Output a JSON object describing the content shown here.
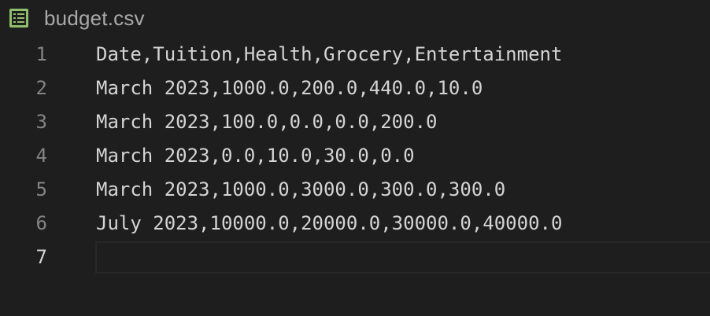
{
  "tab": {
    "file_name": "budget.csv",
    "icon": "spreadsheet-icon",
    "icon_color": "#8ec07c"
  },
  "editor": {
    "lines": [
      {
        "number": "1",
        "text": "Date,Tuition,Health,Grocery,Entertainment"
      },
      {
        "number": "2",
        "text": "March 2023,1000.0,200.0,440.0,10.0"
      },
      {
        "number": "3",
        "text": "March 2023,100.0,0.0,0.0,200.0"
      },
      {
        "number": "4",
        "text": "March 2023,0.0,10.0,30.0,0.0"
      },
      {
        "number": "5",
        "text": "March 2023,1000.0,3000.0,300.0,300.0"
      },
      {
        "number": "6",
        "text": "July 2023,10000.0,20000.0,30000.0,40000.0"
      },
      {
        "number": "7",
        "text": ""
      }
    ],
    "active_line": "7"
  },
  "colors": {
    "background": "#1e1e1e",
    "text": "#d4d4d4",
    "line_number": "#858585"
  }
}
